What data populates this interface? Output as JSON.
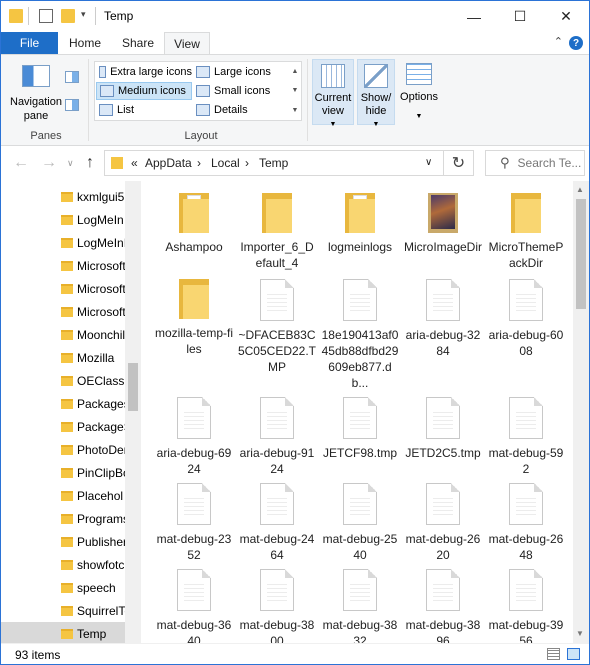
{
  "window": {
    "title": "Temp"
  },
  "ribbon_tabs": [
    "File",
    "Home",
    "Share",
    "View"
  ],
  "ribbon": {
    "panes": {
      "navigation_pane": "Navigation\npane",
      "group": "Panes"
    },
    "layout": {
      "items": [
        "Extra large icons",
        "Large icons",
        "Medium icons",
        "Small icons",
        "List",
        "Details"
      ],
      "selected": "Medium icons",
      "group": "Layout"
    },
    "current_view": "Current\nview",
    "show_hide": "Show/\nhide",
    "options": "Options"
  },
  "address": {
    "prefix": "«",
    "path": [
      "AppData",
      "Local",
      "Temp"
    ],
    "search_placeholder": "Search Te..."
  },
  "tree": [
    "kxmlgui5",
    "LogMeIn",
    "LogMeInI",
    "Microsoft",
    "Microsoft",
    "Microsoft",
    "Moonchil",
    "Mozilla",
    "OEClassic",
    "Packages",
    "PackageS",
    "PhotoDer",
    "PinClipBo",
    "Placehol",
    "Programs",
    "Publisher",
    "showfotc",
    "speech",
    "SquirrelTe",
    "Temp"
  ],
  "tree_selected": "Temp",
  "files": [
    {
      "name": "Ashampoo",
      "kind": "folder-doc"
    },
    {
      "name": "Importer_6_Default_4",
      "kind": "folder"
    },
    {
      "name": "logmeinlogs",
      "kind": "folder-doc"
    },
    {
      "name": "MicroImageDir",
      "kind": "folder-image"
    },
    {
      "name": "MicroThemePackDir",
      "kind": "folder"
    },
    {
      "name": "mozilla-temp-files",
      "kind": "folder"
    },
    {
      "name": "~DFACEB83C5C05CED22.TMP",
      "kind": "file"
    },
    {
      "name": "18e190413af045db88dfbd29609eb877.db...",
      "kind": "file"
    },
    {
      "name": "aria-debug-3284",
      "kind": "file"
    },
    {
      "name": "aria-debug-6008",
      "kind": "file"
    },
    {
      "name": "aria-debug-6924",
      "kind": "file"
    },
    {
      "name": "aria-debug-9124",
      "kind": "file"
    },
    {
      "name": "JETCF98.tmp",
      "kind": "file"
    },
    {
      "name": "JETD2C5.tmp",
      "kind": "file"
    },
    {
      "name": "mat-debug-592",
      "kind": "file"
    },
    {
      "name": "mat-debug-2352",
      "kind": "file"
    },
    {
      "name": "mat-debug-2464",
      "kind": "file"
    },
    {
      "name": "mat-debug-2540",
      "kind": "file"
    },
    {
      "name": "mat-debug-2620",
      "kind": "file"
    },
    {
      "name": "mat-debug-2648",
      "kind": "file"
    },
    {
      "name": "mat-debug-3640",
      "kind": "file"
    },
    {
      "name": "mat-debug-3800",
      "kind": "file"
    },
    {
      "name": "mat-debug-3832",
      "kind": "file"
    },
    {
      "name": "mat-debug-3896",
      "kind": "file"
    },
    {
      "name": "mat-debug-3956",
      "kind": "file"
    }
  ],
  "status": {
    "item_count": "93 items"
  },
  "colors": {
    "accent": "#1e6ec8",
    "folder": "#f5c542",
    "selection": "#cce4f7"
  }
}
